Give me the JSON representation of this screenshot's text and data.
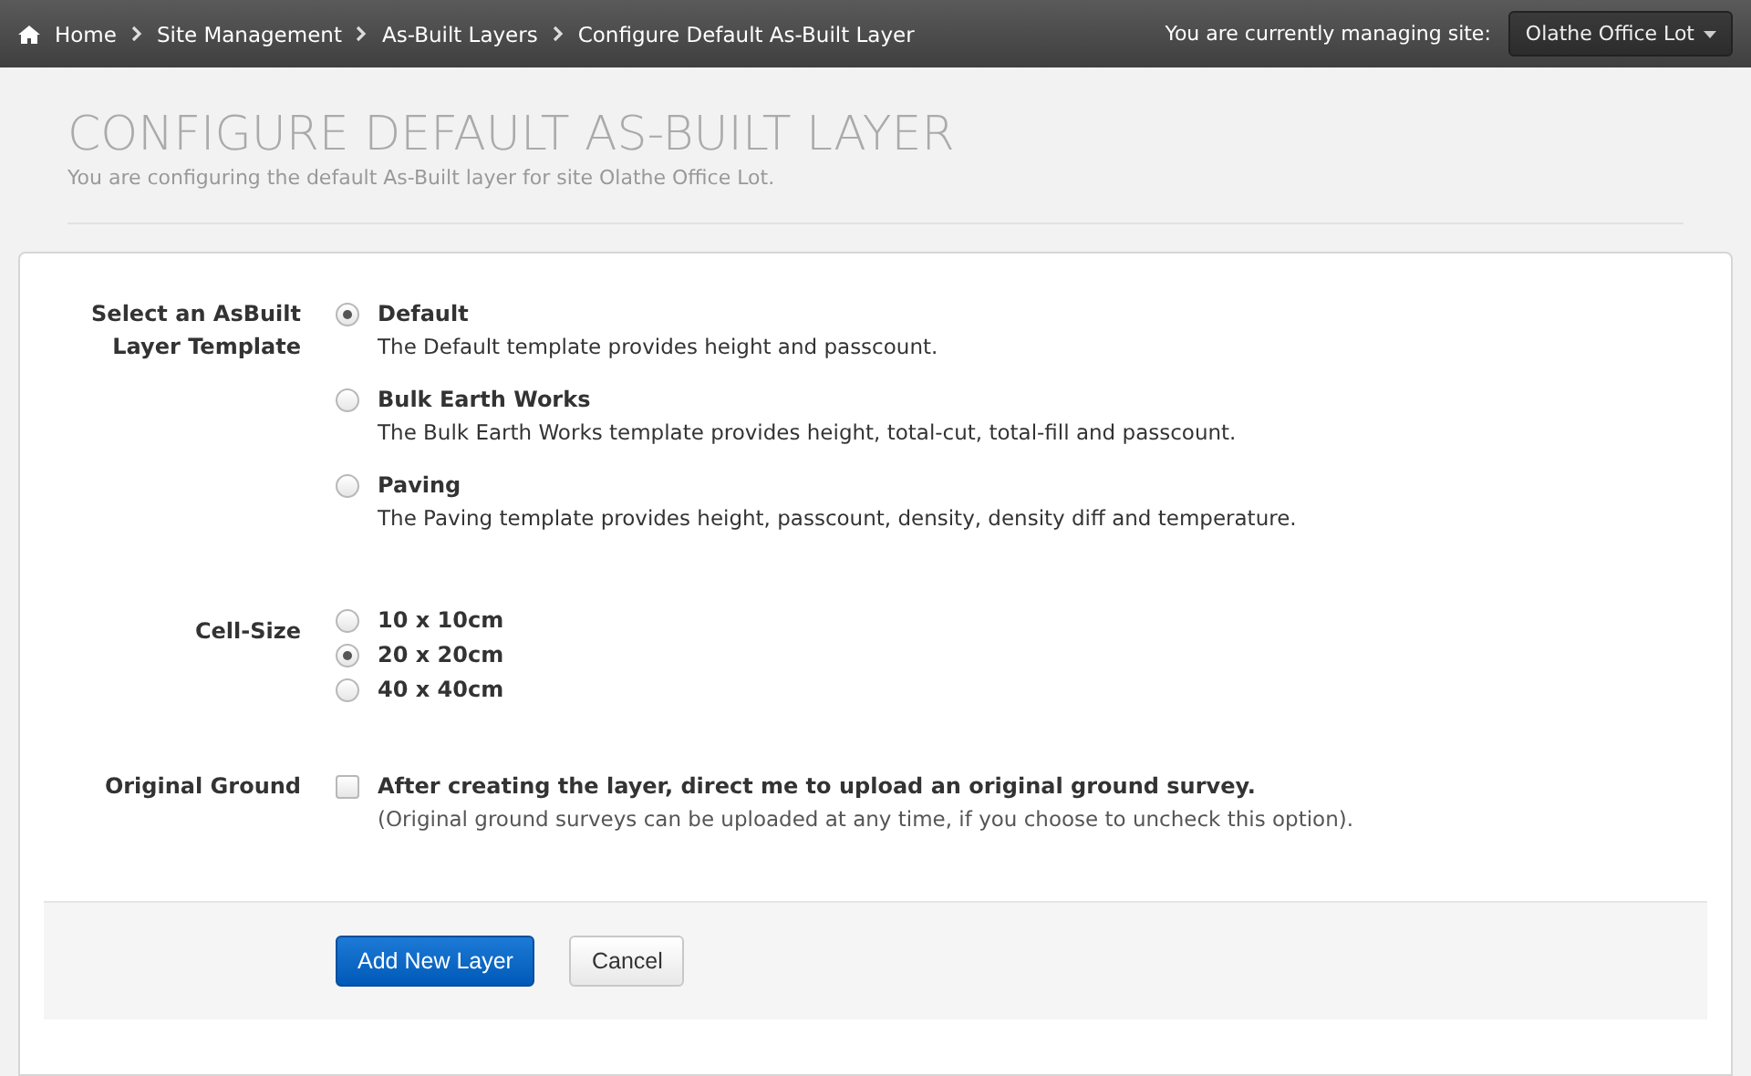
{
  "breadcrumbs": [
    {
      "label": "Home"
    },
    {
      "label": "Site Management"
    },
    {
      "label": "As-Built Layers"
    },
    {
      "label": "Configure Default As-Built Layer"
    }
  ],
  "site": {
    "label": "You are currently managing site:",
    "value": "Olathe Office Lot"
  },
  "page": {
    "title": "CONFIGURE DEFAULT AS-BUILT LAYER",
    "subtitle": "You are configuring the default As-Built layer for site Olathe Office Lot."
  },
  "form": {
    "fields": [
      {
        "kind": "radio",
        "label": "Select an AsBuilt Layer Template",
        "options": [
          {
            "label": "Default",
            "description": "The Default template provides height and passcount.",
            "selected": true
          },
          {
            "label": "Bulk Earth Works",
            "description": "The Bulk Earth Works template provides height, total-cut, total-fill and passcount.",
            "selected": false
          },
          {
            "label": "Paving",
            "description": "The Paving template provides height, passcount, density, density diff and temperature.",
            "selected": false
          }
        ]
      },
      {
        "kind": "radio",
        "label": "Cell-Size",
        "options": [
          {
            "label": "10 x 10cm",
            "selected": false
          },
          {
            "label": "20 x 20cm",
            "selected": true
          },
          {
            "label": "40 x 40cm",
            "selected": false
          }
        ]
      },
      {
        "kind": "checkbox",
        "label": "Original Ground",
        "option": {
          "label": "After creating the layer, direct me to upload an original ground survey.",
          "description": "(Original ground surveys can be uploaded at any time, if you choose to uncheck this option).",
          "checked": false
        }
      }
    ]
  },
  "buttons": [
    {
      "label": "Add New Layer",
      "kind": "primary"
    },
    {
      "label": "Cancel",
      "kind": "default"
    }
  ]
}
